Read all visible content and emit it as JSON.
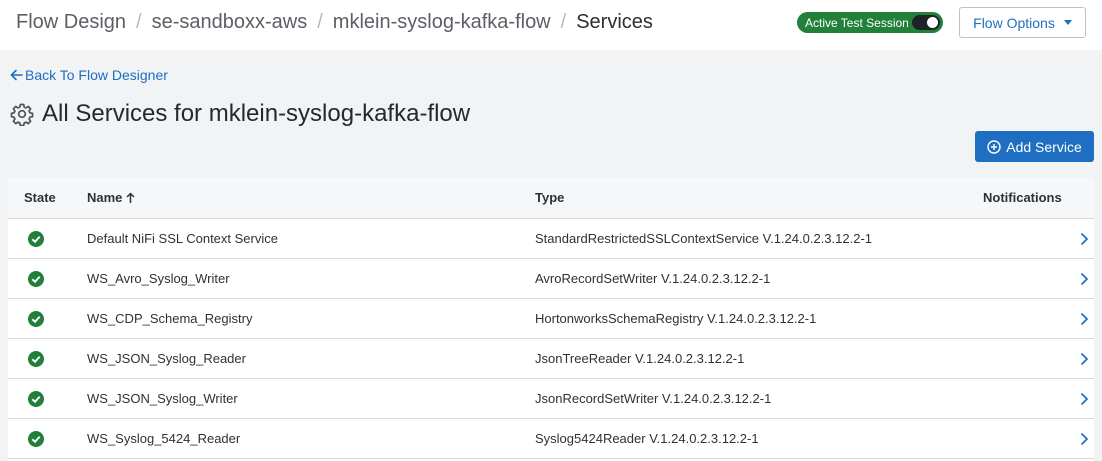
{
  "breadcrumb": {
    "items": [
      "Flow Design",
      "se-sandboxx-aws",
      "mklein-syslog-kafka-flow"
    ],
    "current": "Services",
    "separator": "/"
  },
  "session": {
    "label": "Active Test Session"
  },
  "flow_options": {
    "label": "Flow Options"
  },
  "back_link": {
    "label": "Back To Flow Designer"
  },
  "page": {
    "title": "All Services for mklein-syslog-kafka-flow"
  },
  "add_service": {
    "label": "Add Service"
  },
  "table": {
    "columns": {
      "state": "State",
      "name": "Name",
      "type": "Type",
      "notifications": "Notifications"
    },
    "rows": [
      {
        "name": "Default NiFi SSL Context Service",
        "type": "StandardRestrictedSSLContextService V.1.24.0.2.3.12.2-1"
      },
      {
        "name": "WS_Avro_Syslog_Writer",
        "type": "AvroRecordSetWriter V.1.24.0.2.3.12.2-1"
      },
      {
        "name": "WS_CDP_Schema_Registry",
        "type": "HortonworksSchemaRegistry V.1.24.0.2.3.12.2-1"
      },
      {
        "name": "WS_JSON_Syslog_Reader",
        "type": "JsonTreeReader V.1.24.0.2.3.12.2-1"
      },
      {
        "name": "WS_JSON_Syslog_Writer",
        "type": "JsonRecordSetWriter V.1.24.0.2.3.12.2-1"
      },
      {
        "name": "WS_Syslog_5424_Reader",
        "type": "Syslog5424Reader V.1.24.0.2.3.12.2-1"
      }
    ]
  },
  "icons": {
    "page": "gear-icon",
    "back": "arrow-left-icon",
    "add": "plus-circle-icon",
    "sort": "sort-ascending-icon",
    "state": "check-circle-icon",
    "row_action": "chevron-right-icon",
    "dropdown": "caret-down-icon"
  },
  "colors": {
    "accent": "#1e6fc1",
    "success": "#22803b",
    "page_bg": "#f2f3f5"
  }
}
